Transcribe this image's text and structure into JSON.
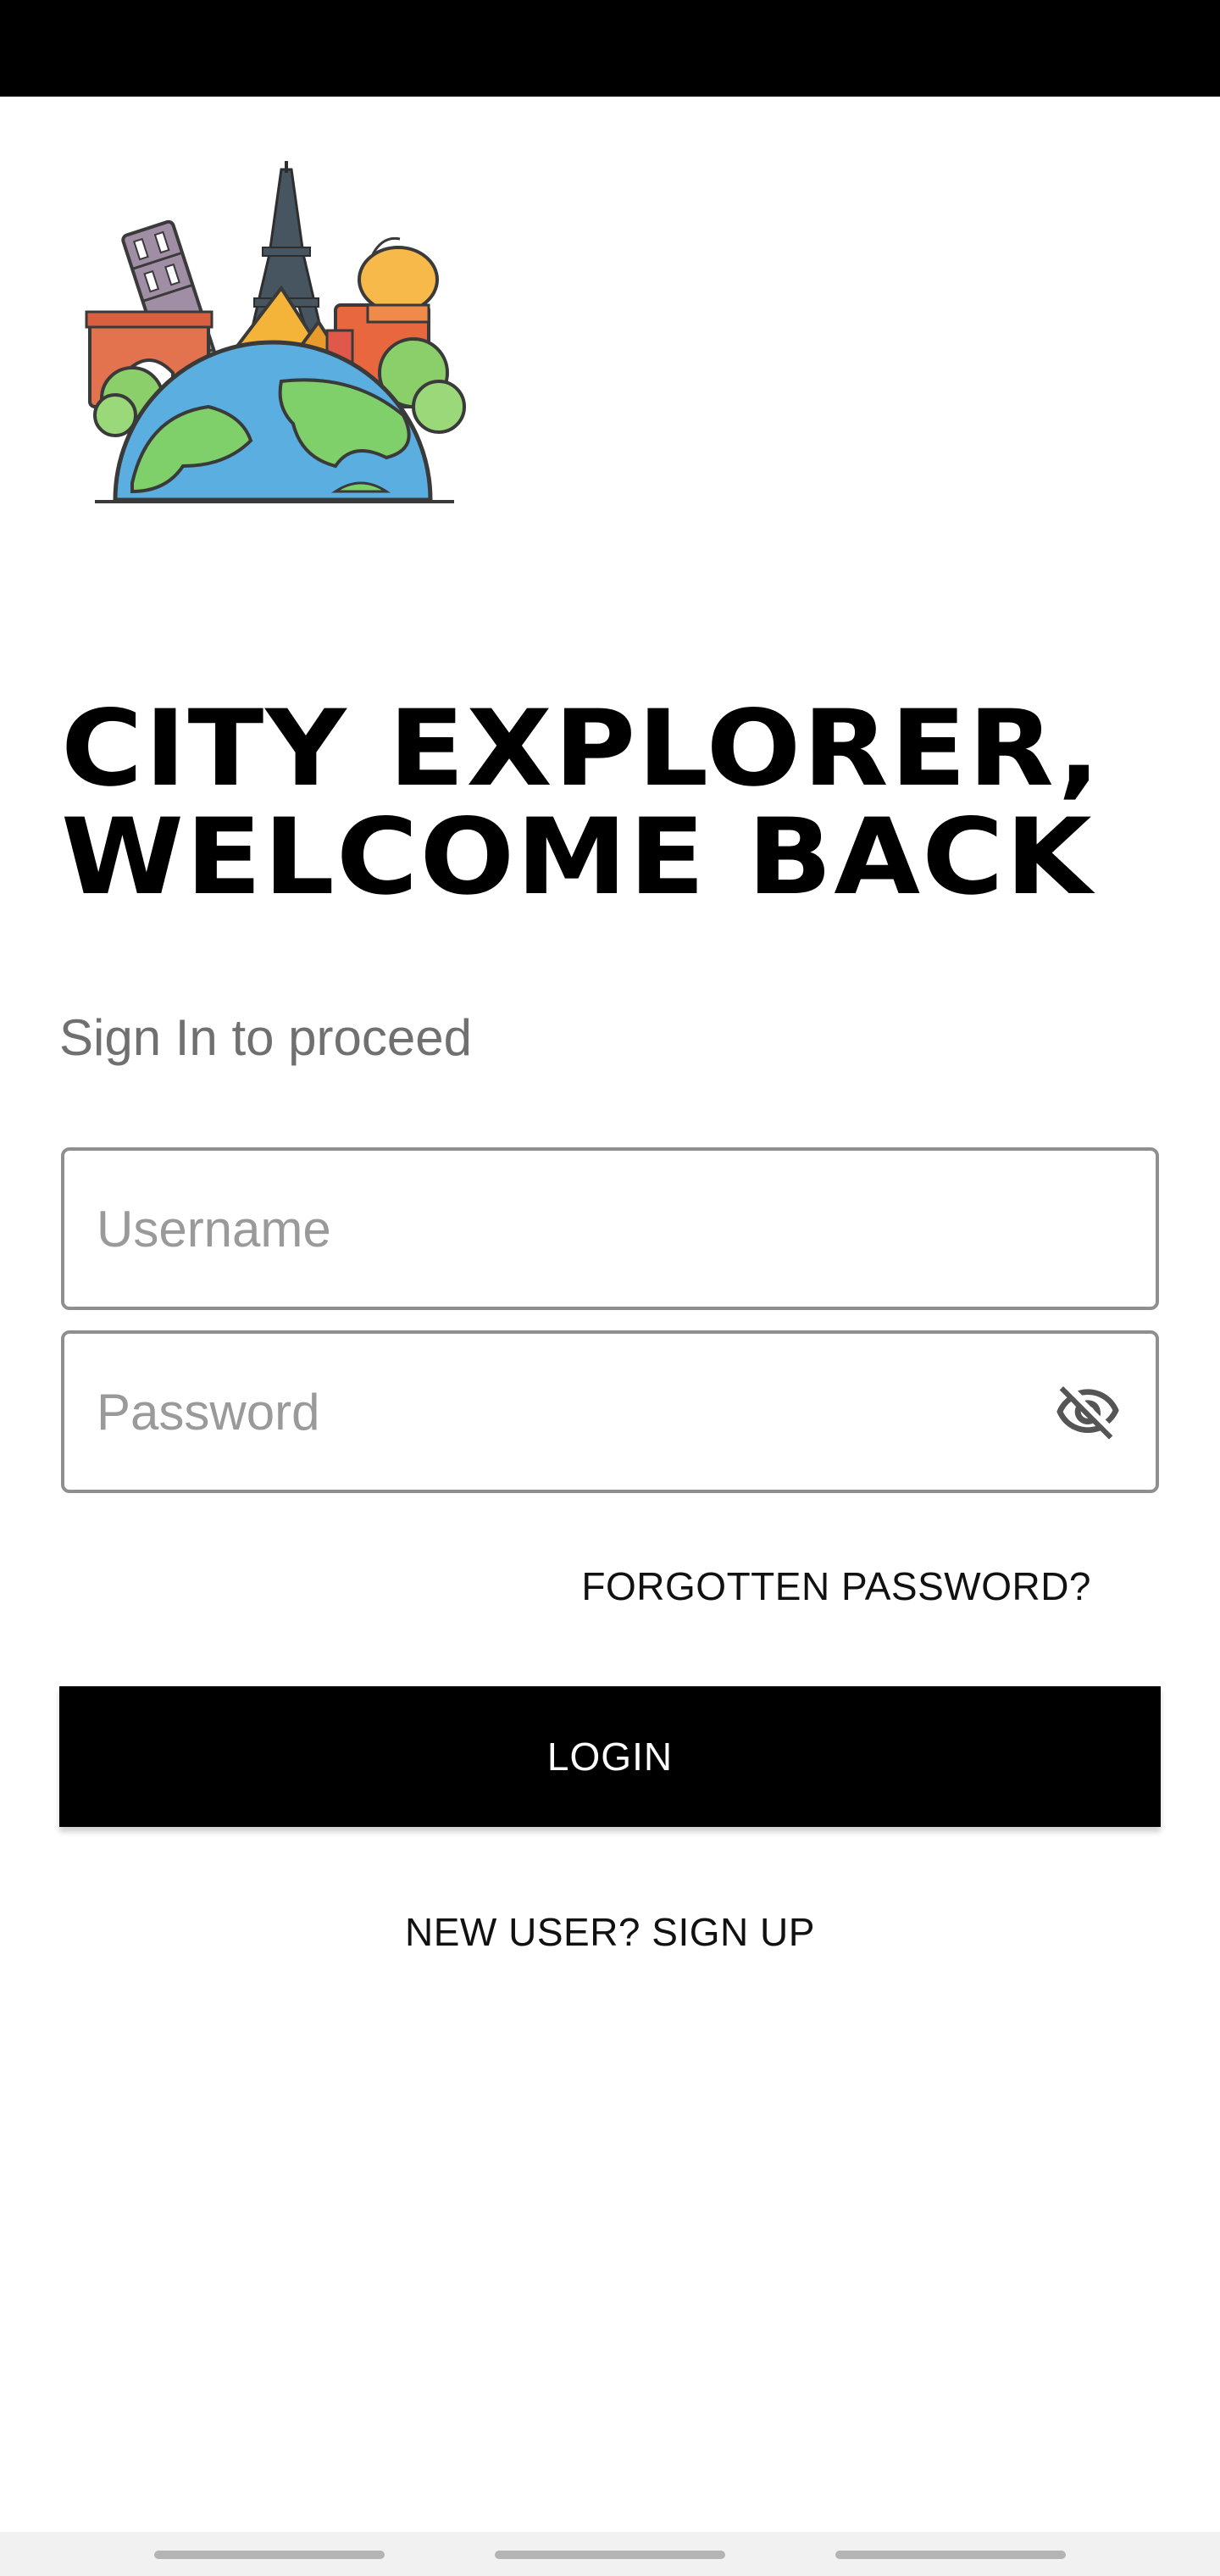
{
  "app": {
    "title_line1": "CITY EXPLORER,",
    "title_line2": "WELCOME BACK",
    "subtitle": "Sign In to proceed",
    "logo_icon": "city-landmarks-globe-illustration"
  },
  "form": {
    "username_placeholder": "Username",
    "username_value": "",
    "password_placeholder": "Password",
    "password_value": "",
    "password_visibility_icon": "eye-off-icon",
    "forgot_label": "FORGOTTEN PASSWORD?",
    "login_label": "LOGIN",
    "signup_label": "NEW USER? SIGN UP"
  },
  "theme": {
    "primary": "#000000",
    "background": "#ffffff",
    "muted_text": "#707070",
    "field_border": "#8f8f8f"
  }
}
